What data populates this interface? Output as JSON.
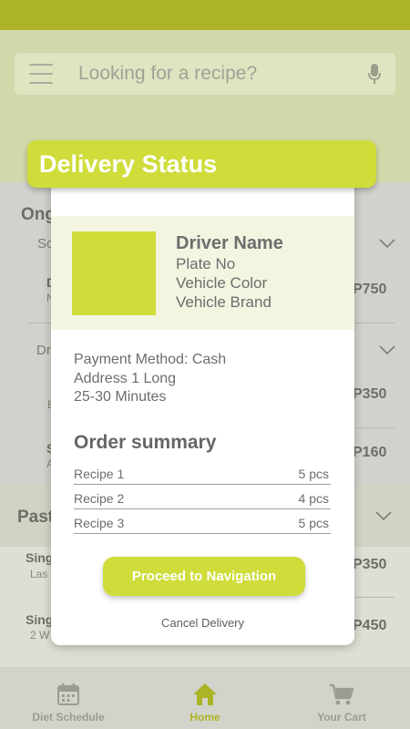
{
  "search": {
    "placeholder": "Looking for a recipe?"
  },
  "background": {
    "ongoing_heading": "Ong",
    "row1_sub": "So",
    "row1_title": "D",
    "row1_small": "N",
    "row1_price": "P750",
    "row2_sub": "Dr",
    "row2_small": "E",
    "row2_price": "P350",
    "row3_title": "S",
    "row3_small": "A",
    "row3_price": "P160",
    "past_heading": "Past",
    "past1_title": "Sing",
    "past1_small": "Las",
    "past1_price": "P350",
    "past2_title": "Sing",
    "past2_small": "2 W",
    "past2_price": "P450"
  },
  "modal": {
    "title": "Delivery Status",
    "driver": {
      "name": "Driver Name",
      "plate": "Plate No",
      "color": "Vehicle Color",
      "brand": "Vehicle Brand"
    },
    "payment": {
      "method": "Payment Method: Cash",
      "address": "Address 1 Long",
      "eta": "25-30 Minutes"
    },
    "summary_title": "Order summary",
    "items": [
      {
        "name": "Recipe 1",
        "qty": "5 pcs"
      },
      {
        "name": "Recipe 2",
        "qty": "4 pcs"
      },
      {
        "name": "Recipe 3",
        "qty": "5 pcs"
      }
    ],
    "proceed_label": "Proceed to Navigation",
    "cancel_label": "Cancel Delivery"
  },
  "nav": {
    "items": [
      {
        "label": "Diet Schedule",
        "icon": "calendar-icon"
      },
      {
        "label": "Home",
        "icon": "home-icon"
      },
      {
        "label": "Your Cart",
        "icon": "cart-icon"
      }
    ]
  },
  "colors": {
    "accent": "#cfdc3a",
    "topbar": "#adb327",
    "text": "#6d6d6d"
  }
}
